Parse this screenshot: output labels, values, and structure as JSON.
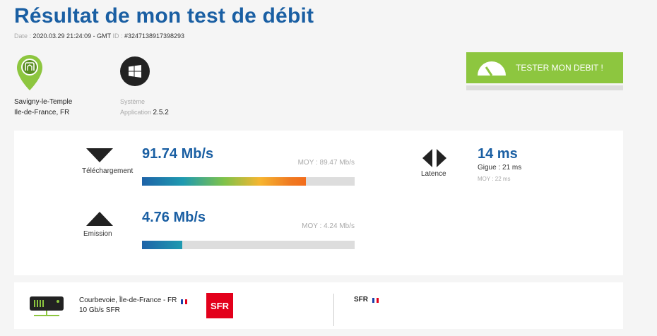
{
  "header": {
    "title": "Résultat de mon test de débit",
    "date_label": "Date : ",
    "date_value": "2020.03.29 21:24:09 - GMT",
    "id_label": " ID : ",
    "id_value": "#3247138917398293"
  },
  "location": {
    "city": "Savigny-le-Temple",
    "region": "Ile-de-France, FR",
    "icon": "location-pin-icon"
  },
  "system": {
    "label": "Système",
    "app_label": "Application ",
    "app_version": "2.5.2",
    "icon": "windows-icon"
  },
  "action": {
    "test_button": "TESTER MON DEBIT !",
    "icon": "speedometer-icon"
  },
  "download": {
    "label": "Téléchargement",
    "speed": "91.74 Mb/s",
    "moy": "MOY : 89.47 Mb/s",
    "fill_fraction": 0.77
  },
  "upload": {
    "label": "Emission",
    "speed": "4.76 Mb/s",
    "moy": "MOY : 4.24 Mb/s",
    "fill_fraction": 0.19
  },
  "latency": {
    "label": "Latence",
    "value": "14 ms",
    "jitter": "Gigue : 21 ms",
    "moy": "MOY : 22 ms"
  },
  "server": {
    "location": "Courbevoie, Île-de-France - FR",
    "capacity": "10 Gb/s SFR",
    "provider_logo_text": "SFR",
    "icon": "server-icon"
  },
  "isp": {
    "name": "SFR"
  },
  "colors": {
    "brand_blue": "#1a5fa3",
    "green": "#8dc63f",
    "sfr_red": "#e3001b"
  }
}
